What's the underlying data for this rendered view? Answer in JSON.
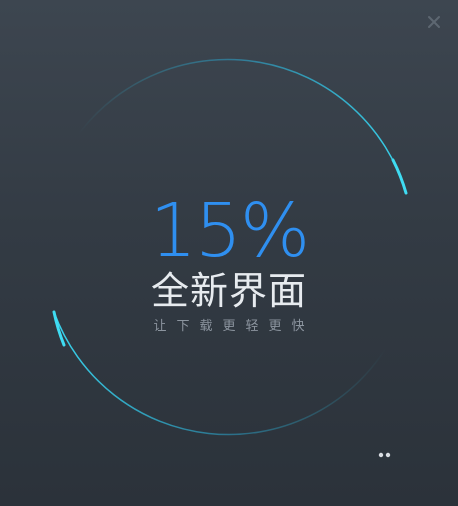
{
  "window": {
    "close_symbol": "×"
  },
  "progress": {
    "percent_value": 15,
    "percent_text": "15%"
  },
  "splash": {
    "title": "全新界面",
    "subtitle": "让下载更轻更快"
  },
  "icons": {
    "close": "close-icon",
    "loading": "loading-dots-icon"
  },
  "colors": {
    "background_top": "#3d4650",
    "background_bottom": "#2b323a",
    "accent_cyan": "#2ec6e6",
    "accent_blue": "#2f8ff0",
    "title_text": "#e7ebef",
    "subtitle_text": "#8c959f"
  }
}
